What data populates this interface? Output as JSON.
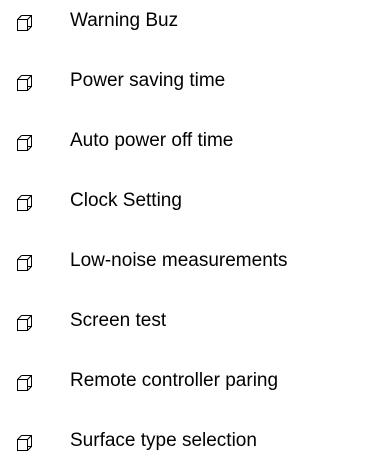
{
  "bullet_icon": "page-stack-icon",
  "items": [
    {
      "label": "Warning Buz"
    },
    {
      "label": "Power saving time"
    },
    {
      "label": "Auto power off time"
    },
    {
      "label": "Clock Setting"
    },
    {
      "label": "Low-noise measurements"
    },
    {
      "label": "Screen test"
    },
    {
      "label": "Remote controller paring"
    },
    {
      "label": "Surface type selection"
    }
  ]
}
